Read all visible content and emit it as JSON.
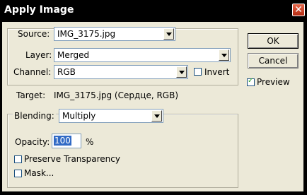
{
  "window": {
    "title": "Apply Image"
  },
  "source": {
    "label": "Source:",
    "value": "IMG_3175.jpg",
    "layer_label": "Layer:",
    "layer_value": "Merged",
    "channel_label": "Channel:",
    "channel_value": "RGB",
    "invert_label": "Invert",
    "invert_checked": false
  },
  "target": {
    "label": "Target:",
    "value": "IMG_3175.jpg (Сердце, RGB)"
  },
  "blending": {
    "label": "Blending:",
    "value": "Multiply",
    "opacity_label": "Opacity:",
    "opacity_value": "100",
    "opacity_unit": "%",
    "preserve_label": "Preserve Transparency",
    "preserve_checked": false,
    "mask_label": "Mask...",
    "mask_checked": false
  },
  "buttons": {
    "ok": "OK",
    "cancel": "Cancel"
  },
  "preview": {
    "label": "Preview",
    "checked": true
  }
}
